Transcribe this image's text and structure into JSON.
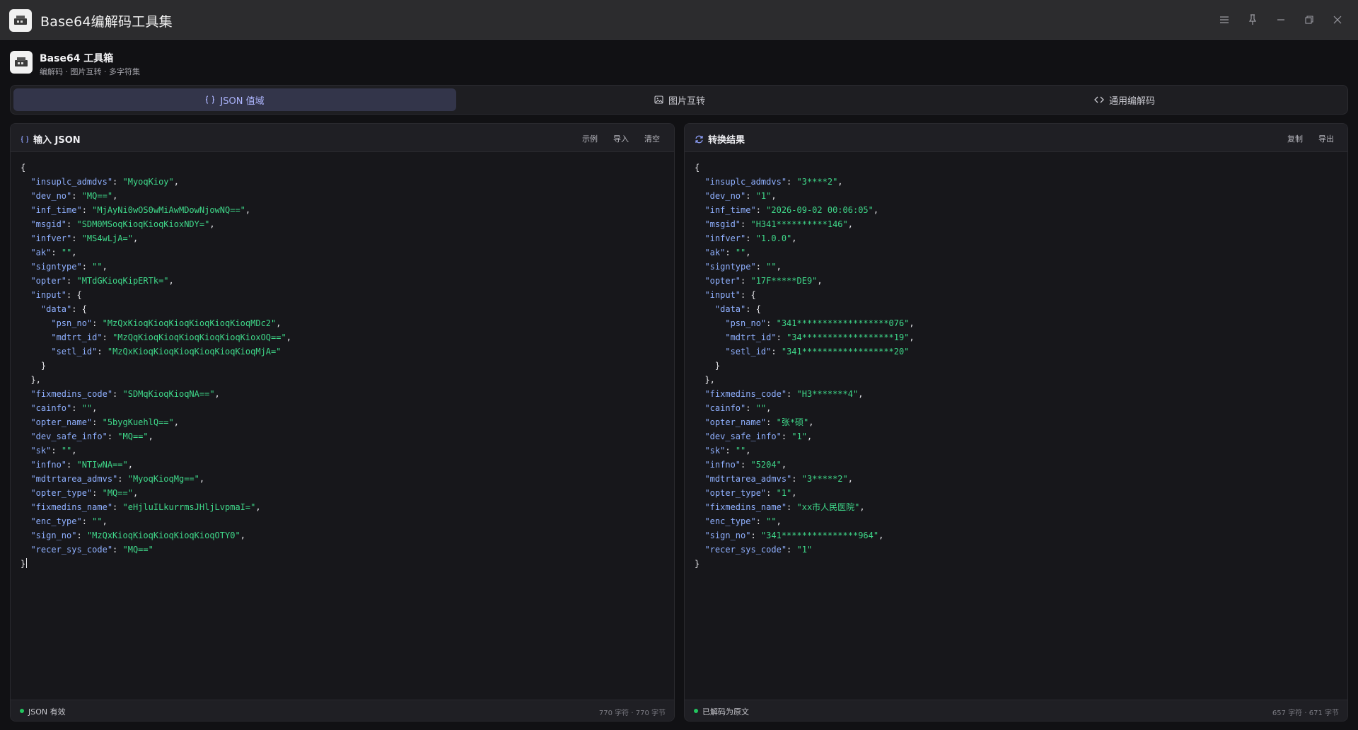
{
  "window": {
    "title": "Base64编解码工具集"
  },
  "header": {
    "title": "Base64 工具箱",
    "subtitle": "编解码 · 图片互转 · 多字符集"
  },
  "tabs": [
    {
      "label": "JSON 值域",
      "icon": "braces-icon",
      "active": true
    },
    {
      "label": "图片互转",
      "icon": "image-icon",
      "active": false
    },
    {
      "label": "通用编解码",
      "icon": "code-icon",
      "active": false
    }
  ],
  "input_panel": {
    "title": "输入 JSON",
    "actions": {
      "example": "示例",
      "import": "导入",
      "clear": "清空"
    },
    "lines": [
      [
        "",
        "{",
        "",
        ""
      ],
      [
        "  ",
        "\"insuplc_admdvs\"",
        "\"MyoqKioy\"",
        ","
      ],
      [
        "  ",
        "\"dev_no\"",
        "\"MQ==\"",
        ","
      ],
      [
        "  ",
        "\"inf_time\"",
        "\"MjAyNi0wOS0wMiAwMDowNjowNQ==\"",
        ","
      ],
      [
        "  ",
        "\"msgid\"",
        "\"SDM0MSoqKioqKioqKioxNDY=\"",
        ","
      ],
      [
        "  ",
        "\"infver\"",
        "\"MS4wLjA=\"",
        ","
      ],
      [
        "  ",
        "\"ak\"",
        "\"\"",
        ","
      ],
      [
        "  ",
        "\"signtype\"",
        "\"\"",
        ","
      ],
      [
        "  ",
        "\"opter\"",
        "\"MTdGKioqKipERTk=\"",
        ","
      ],
      [
        "  ",
        "\"input\"",
        "{",
        ""
      ],
      [
        "    ",
        "\"data\"",
        "{",
        ""
      ],
      [
        "      ",
        "\"psn_no\"",
        "\"MzQxKioqKioqKioqKioqKioqKioqMDc2\"",
        ","
      ],
      [
        "      ",
        "\"mdtrt_id\"",
        "\"MzQqKioqKioqKioqKioqKioqKioxOQ==\"",
        ","
      ],
      [
        "      ",
        "\"setl_id\"",
        "\"MzQxKioqKioqKioqKioqKioqKioqMjA=\"",
        ""
      ],
      [
        "    ",
        "}",
        "",
        ""
      ],
      [
        "  ",
        "},",
        "",
        ""
      ],
      [
        "  ",
        "\"fixmedins_code\"",
        "\"SDMqKioqKioqNA==\"",
        ","
      ],
      [
        "  ",
        "\"cainfo\"",
        "\"\"",
        ","
      ],
      [
        "  ",
        "\"opter_name\"",
        "\"5bygKuehlQ==\"",
        ","
      ],
      [
        "  ",
        "\"dev_safe_info\"",
        "\"MQ==\"",
        ","
      ],
      [
        "  ",
        "\"sk\"",
        "\"\"",
        ","
      ],
      [
        "  ",
        "\"infno\"",
        "\"NTIwNA==\"",
        ","
      ],
      [
        "  ",
        "\"mdtrtarea_admvs\"",
        "\"MyoqKioqMg==\"",
        ","
      ],
      [
        "  ",
        "\"opter_type\"",
        "\"MQ==\"",
        ","
      ],
      [
        "  ",
        "\"fixmedins_name\"",
        "\"eHjluILkurrmsJHljLvpmaI=\"",
        ","
      ],
      [
        "  ",
        "\"enc_type\"",
        "\"\"",
        ","
      ],
      [
        "  ",
        "\"sign_no\"",
        "\"MzQxKioqKioqKioqKioqKioqOTY0\"",
        ","
      ],
      [
        "  ",
        "\"recer_sys_code\"",
        "\"MQ==\"",
        ""
      ],
      [
        "",
        "}",
        "",
        ""
      ]
    ],
    "status": "JSON 有效",
    "count": "770 字符 · 770 字节"
  },
  "output_panel": {
    "title": "转换结果",
    "actions": {
      "copy": "复制",
      "export": "导出"
    },
    "lines": [
      [
        "",
        "{",
        "",
        ""
      ],
      [
        "  ",
        "\"insuplc_admdvs\"",
        "\"3****2\"",
        ","
      ],
      [
        "  ",
        "\"dev_no\"",
        "\"1\"",
        ","
      ],
      [
        "  ",
        "\"inf_time\"",
        "\"2026-09-02 00:06:05\"",
        ","
      ],
      [
        "  ",
        "\"msgid\"",
        "\"H341**********146\"",
        ","
      ],
      [
        "  ",
        "\"infver\"",
        "\"1.0.0\"",
        ","
      ],
      [
        "  ",
        "\"ak\"",
        "\"\"",
        ","
      ],
      [
        "  ",
        "\"signtype\"",
        "\"\"",
        ","
      ],
      [
        "  ",
        "\"opter\"",
        "\"17F*****DE9\"",
        ","
      ],
      [
        "  ",
        "\"input\"",
        "{",
        ""
      ],
      [
        "    ",
        "\"data\"",
        "{",
        ""
      ],
      [
        "      ",
        "\"psn_no\"",
        "\"341******************076\"",
        ","
      ],
      [
        "      ",
        "\"mdtrt_id\"",
        "\"34******************19\"",
        ","
      ],
      [
        "      ",
        "\"setl_id\"",
        "\"341******************20\"",
        ""
      ],
      [
        "    ",
        "}",
        "",
        ""
      ],
      [
        "  ",
        "},",
        "",
        ""
      ],
      [
        "  ",
        "\"fixmedins_code\"",
        "\"H3*******4\"",
        ","
      ],
      [
        "  ",
        "\"cainfo\"",
        "\"\"",
        ","
      ],
      [
        "  ",
        "\"opter_name\"",
        "\"张*硕\"",
        ","
      ],
      [
        "  ",
        "\"dev_safe_info\"",
        "\"1\"",
        ","
      ],
      [
        "  ",
        "\"sk\"",
        "\"\"",
        ","
      ],
      [
        "  ",
        "\"infno\"",
        "\"5204\"",
        ","
      ],
      [
        "  ",
        "\"mdtrtarea_admvs\"",
        "\"3*****2\"",
        ","
      ],
      [
        "  ",
        "\"opter_type\"",
        "\"1\"",
        ","
      ],
      [
        "  ",
        "\"fixmedins_name\"",
        "\"xx市人民医院\"",
        ","
      ],
      [
        "  ",
        "\"enc_type\"",
        "\"\"",
        ","
      ],
      [
        "  ",
        "\"sign_no\"",
        "\"341***************964\"",
        ","
      ],
      [
        "  ",
        "\"recer_sys_code\"",
        "\"1\"",
        ""
      ],
      [
        "",
        "}",
        "",
        ""
      ]
    ],
    "status": "已解码为原文",
    "count": "657 字符 · 671 字节"
  },
  "colors": {
    "accent": "#aeb6ff",
    "json_key": "#8fb0ff",
    "json_string": "#3fd98a",
    "status_ok": "#22c55e"
  }
}
